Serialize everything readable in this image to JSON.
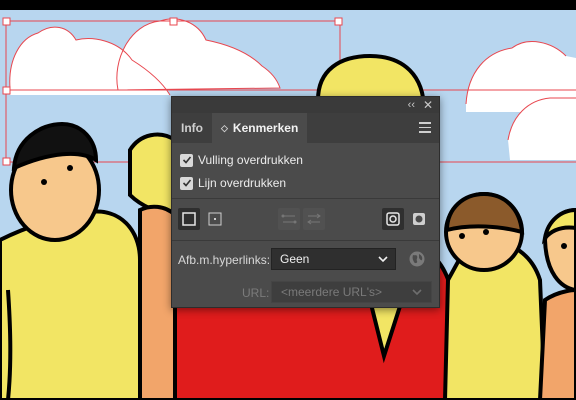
{
  "panel": {
    "collapse_icon": "double-chevron-right-icon",
    "close_icon": "close-icon",
    "tabs": [
      {
        "label": "Info",
        "active": false
      },
      {
        "label": "Kenmerken",
        "active": true
      }
    ],
    "menu_icon": "hamburger-menu-icon"
  },
  "attributes": {
    "fill_overprint": {
      "label": "Vulling overdrukken",
      "checked": true
    },
    "stroke_overprint": {
      "label": "Lijn overdrukken",
      "checked": true
    }
  },
  "hyperlinks": {
    "label": "Afb.m.hyperlinks:",
    "value": "Geen",
    "url_label": "URL:",
    "url_placeholder": "<meerdere URL's>"
  },
  "colors": {
    "panel_bg": "#4b4b4b",
    "tab_bar": "#3e3e3e",
    "sky": "#b8d6ef",
    "selection": "#e8474f"
  }
}
